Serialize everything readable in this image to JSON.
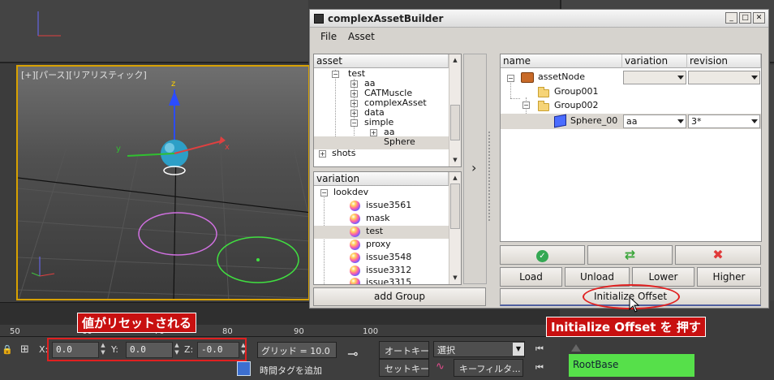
{
  "viewport": {
    "label": "[+][パース][リアリスティック]"
  },
  "timeline": {
    "ticks": [
      "50",
      "60",
      "70",
      "80",
      "90",
      "100"
    ]
  },
  "status": {
    "x_label": "X:",
    "x_value": "0.0",
    "y_label": "Y:",
    "y_value": "0.0",
    "z_label": "Z:",
    "z_value": "-0.0",
    "grid": "グリッド = 10.0",
    "add_time_tag": "時間タグを追加",
    "auto_key": "オートキー",
    "set_key": "セットキー",
    "select_value": "選択",
    "key_filter": "キーフィルタ..."
  },
  "annotations": {
    "reset_note": "値がリセットされる",
    "press_note": "Initialize Offset を 押す"
  },
  "rootbase": "RootBase",
  "dialog": {
    "title": "complexAssetBuilder",
    "menu": [
      "File",
      "Asset"
    ],
    "asset_tree": {
      "header": "asset",
      "items": [
        "test",
        "aa",
        "CATMuscle",
        "complexAsset",
        "data",
        "simple",
        "aa",
        "Sphere",
        "shots"
      ]
    },
    "variation_list": {
      "header": "variation",
      "items": [
        "lookdev",
        "issue3561",
        "mask",
        "test",
        "proxy",
        "issue3548",
        "issue3312",
        "issue3315"
      ]
    },
    "add_group": "add Group",
    "arrow_button": "›",
    "node_table": {
      "columns": [
        "name",
        "variation",
        "revision"
      ],
      "rows": [
        {
          "name": "assetNode",
          "variation": "",
          "revision": ""
        },
        {
          "name": "Group001",
          "variation": "",
          "revision": ""
        },
        {
          "name": "Group002",
          "variation": "",
          "revision": ""
        },
        {
          "name": "Sphere_00",
          "variation": "aa",
          "revision": "3*"
        }
      ]
    },
    "icon_buttons": {
      "ok": "check-icon",
      "refresh": "refresh-icon",
      "delete": "x-icon"
    },
    "buttons": {
      "load": "Load",
      "unload": "Unload",
      "lower": "Lower",
      "higher": "Higher",
      "initialize_offset": "Initialize Offset"
    },
    "colors": {
      "ok": "#34a853",
      "refresh": "#3aa63a",
      "delete": "#e03a3a"
    }
  }
}
